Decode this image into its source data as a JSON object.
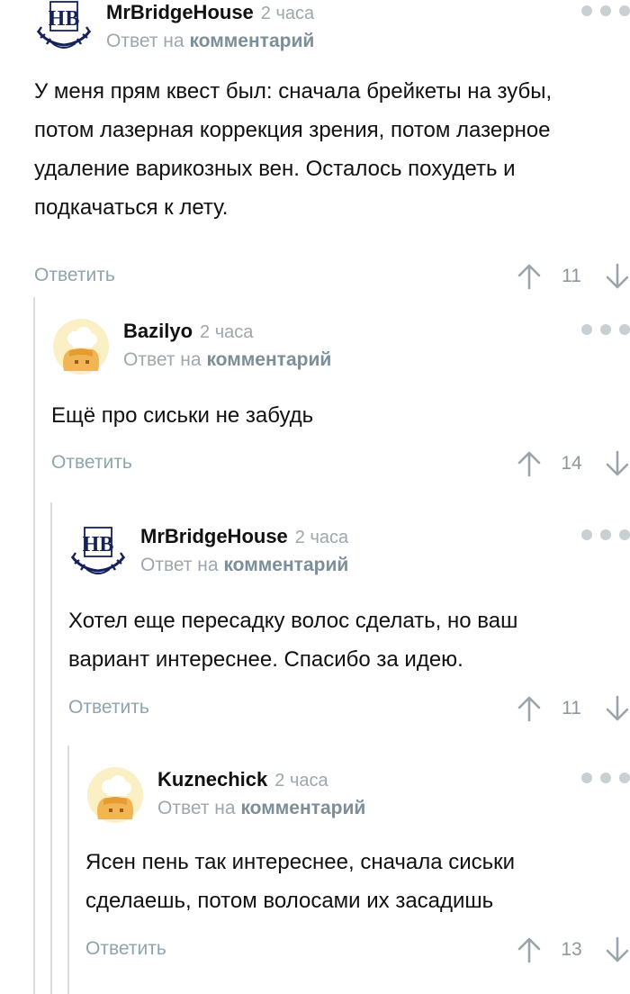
{
  "colors": {
    "thread_line": "#dcdcdc",
    "muted_text": "#9ea7ad",
    "link": "#7c8f99",
    "reply_button": "#8ea5ae",
    "dots": "#c9d0d4"
  },
  "comments": [
    {
      "author": "MrBridgeHouse",
      "time": "2 часа",
      "reply_prefix": "Ответ на",
      "reply_link": "комментарий",
      "text": "У меня прям квест был: сначала брейкеты на зубы, потом лазерная коррекция зрения, потом лазерное удаление варикозных вен. Осталось похудеть и подкачаться к лету.",
      "reply_label": "Ответить",
      "score": "11",
      "avatar_icon": "hb-crest-logo"
    },
    {
      "author": "Bazilyo",
      "time": "2 часа",
      "reply_prefix": "Ответ на",
      "reply_link": "комментарий",
      "text": "Ещё про сиськи не забудь",
      "reply_label": "Ответить",
      "score": "14",
      "avatar_icon": "chef-bun-avatar"
    },
    {
      "author": "MrBridgeHouse",
      "time": "2 часа",
      "reply_prefix": "Ответ на",
      "reply_link": "комментарий",
      "text": "Хотел еще пересадку волос сделать, но ваш вариант интереснее. Спасибо за идею.",
      "reply_label": "Ответить",
      "score": "11",
      "avatar_icon": "hb-crest-logo"
    },
    {
      "author": "Kuznechick",
      "time": "2 часа",
      "reply_prefix": "Ответ на",
      "reply_link": "комментарий",
      "text": "Ясен пень так интереснее, сначала сиськи сделаешь, потом волосами их засадишь",
      "reply_label": "Ответить",
      "score": "13",
      "avatar_icon": "chef-bun-avatar"
    }
  ]
}
